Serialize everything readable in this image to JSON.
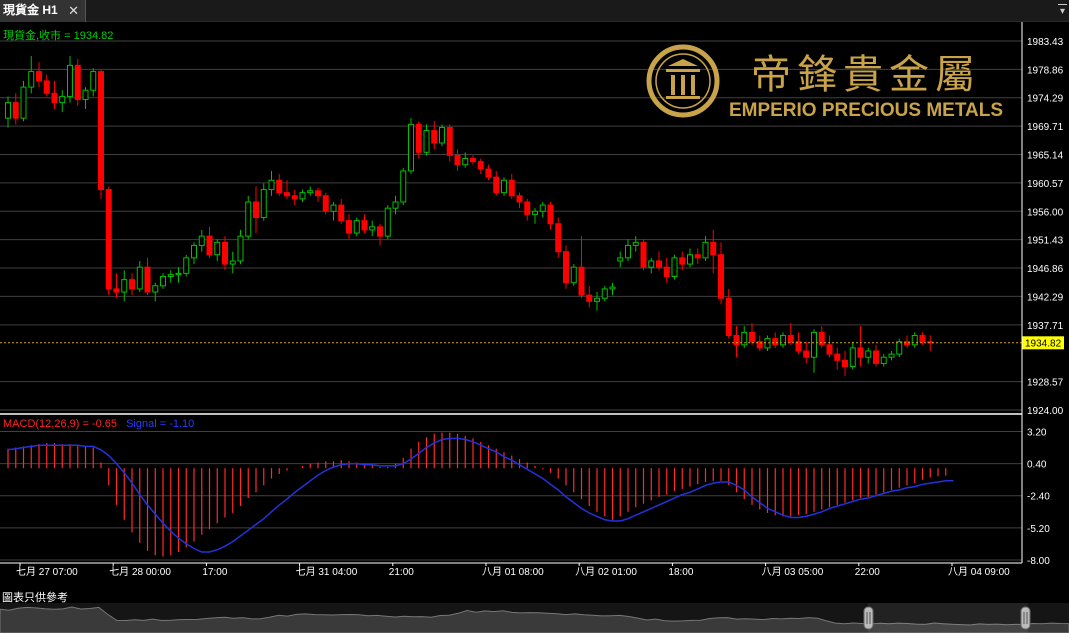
{
  "window": {
    "tab_title": "現貨金 H1",
    "tab_close": "✕",
    "menu_arrow": "▾"
  },
  "colors": {
    "bull": "#00c000",
    "bear": "#ff0000",
    "grid": "#404040",
    "axis_text": "#ffffff",
    "price_tag_bg": "#ffff00",
    "macd_label": "#ff2222",
    "signal_label": "#2233ff",
    "histogram": "#ff2a2a",
    "signal_line": "#2233dd",
    "logo_gold": "#c9a34a"
  },
  "main_panel": {
    "series_label": "現貨金,收市 = 1934.82",
    "current_price": 1934.82,
    "current_price_label": "1934.82",
    "price_ticks": [
      "1983.43",
      "1978.86",
      "1974.29",
      "1969.71",
      "1965.14",
      "1960.57",
      "1956.00",
      "1951.43",
      "1946.86",
      "1942.29",
      "1937.71",
      "1928.57",
      "1924.00"
    ]
  },
  "logo": {
    "chinese": "帝鋒貴金屬",
    "english": "EMPERIO PRECIOUS METALS",
    "icon": "emperio-seal-icon"
  },
  "macd_panel": {
    "label_macd": "MACD(12,26,9) = -0.65",
    "label_signal": "Signal = -1.10",
    "ticks": [
      "3.20",
      "0.40",
      "-2.40",
      "-5.20",
      "-8.00"
    ]
  },
  "time_axis": {
    "labels": [
      "七月 27 07:00",
      "七月 28 00:00",
      "17:00",
      "七月 31 04:00",
      "21:00",
      "八月 01 08:00",
      "八月 02 01:00",
      "18:00",
      "八月 03 05:00",
      "22:00",
      "八月 04 09:00"
    ]
  },
  "footer": {
    "disclaimer": "圖表只供參考"
  },
  "chart_data": {
    "type": "candlestick",
    "symbol": "現貨金",
    "timeframe": "H1",
    "close": 1934.82,
    "y_range": [
      1924.0,
      1986.0
    ],
    "x_labels": [
      "七月 27 07:00",
      "七月 28 00:00",
      "17:00",
      "七月 31 04:00",
      "21:00",
      "八月 01 08:00",
      "八月 02 01:00",
      "18:00",
      "八月 03 05:00",
      "22:00",
      "八月 04 09:00"
    ],
    "candles": [
      {
        "o": 1971.0,
        "h": 1974.5,
        "l": 1969.5,
        "c": 1973.5
      },
      {
        "o": 1973.5,
        "h": 1975.0,
        "l": 1970.0,
        "c": 1971.0
      },
      {
        "o": 1971.0,
        "h": 1977.0,
        "l": 1970.5,
        "c": 1976.0
      },
      {
        "o": 1976.0,
        "h": 1981.0,
        "l": 1975.0,
        "c": 1978.5
      },
      {
        "o": 1978.5,
        "h": 1980.0,
        "l": 1976.0,
        "c": 1977.0
      },
      {
        "o": 1977.0,
        "h": 1978.0,
        "l": 1974.5,
        "c": 1975.0
      },
      {
        "o": 1975.0,
        "h": 1977.0,
        "l": 1972.5,
        "c": 1973.5
      },
      {
        "o": 1973.5,
        "h": 1975.5,
        "l": 1972.0,
        "c": 1974.5
      },
      {
        "o": 1974.5,
        "h": 1981.0,
        "l": 1973.5,
        "c": 1979.5
      },
      {
        "o": 1979.5,
        "h": 1980.5,
        "l": 1973.0,
        "c": 1974.0
      },
      {
        "o": 1974.0,
        "h": 1976.0,
        "l": 1972.5,
        "c": 1975.5
      },
      {
        "o": 1975.5,
        "h": 1979.0,
        "l": 1974.5,
        "c": 1978.5
      },
      {
        "o": 1978.5,
        "h": 1978.8,
        "l": 1958.0,
        "c": 1959.5
      },
      {
        "o": 1959.5,
        "h": 1960.0,
        "l": 1942.5,
        "c": 1943.5
      },
      {
        "o": 1943.5,
        "h": 1946.0,
        "l": 1942.0,
        "c": 1943.0
      },
      {
        "o": 1943.0,
        "h": 1946.5,
        "l": 1941.5,
        "c": 1945.0
      },
      {
        "o": 1945.0,
        "h": 1946.0,
        "l": 1942.5,
        "c": 1943.5
      },
      {
        "o": 1943.5,
        "h": 1948.0,
        "l": 1943.0,
        "c": 1947.0
      },
      {
        "o": 1947.0,
        "h": 1948.5,
        "l": 1942.5,
        "c": 1943.0
      },
      {
        "o": 1943.0,
        "h": 1944.5,
        "l": 1941.5,
        "c": 1944.0
      },
      {
        "o": 1944.0,
        "h": 1946.0,
        "l": 1943.5,
        "c": 1945.5
      },
      {
        "o": 1945.5,
        "h": 1946.5,
        "l": 1944.5,
        "c": 1945.8
      },
      {
        "o": 1945.8,
        "h": 1947.0,
        "l": 1944.5,
        "c": 1946.0
      },
      {
        "o": 1946.0,
        "h": 1949.0,
        "l": 1945.5,
        "c": 1948.5
      },
      {
        "o": 1948.5,
        "h": 1951.0,
        "l": 1947.5,
        "c": 1950.5
      },
      {
        "o": 1950.5,
        "h": 1953.0,
        "l": 1949.5,
        "c": 1952.0
      },
      {
        "o": 1952.0,
        "h": 1953.5,
        "l": 1948.5,
        "c": 1949.0
      },
      {
        "o": 1949.0,
        "h": 1951.5,
        "l": 1948.0,
        "c": 1951.0
      },
      {
        "o": 1951.0,
        "h": 1952.0,
        "l": 1946.5,
        "c": 1947.5
      },
      {
        "o": 1947.5,
        "h": 1949.5,
        "l": 1946.0,
        "c": 1948.0
      },
      {
        "o": 1948.0,
        "h": 1953.0,
        "l": 1947.5,
        "c": 1952.0
      },
      {
        "o": 1952.0,
        "h": 1958.5,
        "l": 1951.5,
        "c": 1957.5
      },
      {
        "o": 1957.5,
        "h": 1960.0,
        "l": 1952.5,
        "c": 1955.0
      },
      {
        "o": 1955.0,
        "h": 1960.5,
        "l": 1954.5,
        "c": 1959.5
      },
      {
        "o": 1959.5,
        "h": 1962.5,
        "l": 1958.5,
        "c": 1961.0
      },
      {
        "o": 1961.0,
        "h": 1962.0,
        "l": 1958.5,
        "c": 1959.0
      },
      {
        "o": 1959.0,
        "h": 1961.0,
        "l": 1958.0,
        "c": 1958.5
      },
      {
        "o": 1958.5,
        "h": 1959.5,
        "l": 1957.0,
        "c": 1958.0
      },
      {
        "o": 1958.0,
        "h": 1959.5,
        "l": 1957.5,
        "c": 1959.0
      },
      {
        "o": 1959.0,
        "h": 1960.0,
        "l": 1958.5,
        "c": 1959.3
      },
      {
        "o": 1959.3,
        "h": 1959.8,
        "l": 1957.5,
        "c": 1958.5
      },
      {
        "o": 1958.5,
        "h": 1959.0,
        "l": 1955.5,
        "c": 1956.0
      },
      {
        "o": 1956.0,
        "h": 1957.5,
        "l": 1954.5,
        "c": 1957.0
      },
      {
        "o": 1957.0,
        "h": 1958.0,
        "l": 1954.0,
        "c": 1954.5
      },
      {
        "o": 1954.5,
        "h": 1955.5,
        "l": 1951.5,
        "c": 1952.5
      },
      {
        "o": 1952.5,
        "h": 1955.0,
        "l": 1952.0,
        "c": 1954.5
      },
      {
        "o": 1954.5,
        "h": 1955.5,
        "l": 1952.5,
        "c": 1953.0
      },
      {
        "o": 1953.0,
        "h": 1954.5,
        "l": 1952.0,
        "c": 1953.5
      },
      {
        "o": 1953.5,
        "h": 1954.0,
        "l": 1950.5,
        "c": 1952.0
      },
      {
        "o": 1952.0,
        "h": 1957.0,
        "l": 1951.5,
        "c": 1956.5
      },
      {
        "o": 1956.5,
        "h": 1958.5,
        "l": 1955.5,
        "c": 1957.5
      },
      {
        "o": 1957.5,
        "h": 1963.0,
        "l": 1957.0,
        "c": 1962.5
      },
      {
        "o": 1962.5,
        "h": 1971.0,
        "l": 1962.0,
        "c": 1970.0
      },
      {
        "o": 1970.0,
        "h": 1970.5,
        "l": 1964.5,
        "c": 1965.5
      },
      {
        "o": 1965.5,
        "h": 1970.0,
        "l": 1965.0,
        "c": 1969.0
      },
      {
        "o": 1969.0,
        "h": 1970.5,
        "l": 1966.0,
        "c": 1967.0
      },
      {
        "o": 1967.0,
        "h": 1970.0,
        "l": 1966.5,
        "c": 1969.5
      },
      {
        "o": 1969.5,
        "h": 1970.0,
        "l": 1964.0,
        "c": 1965.0
      },
      {
        "o": 1965.0,
        "h": 1966.0,
        "l": 1962.5,
        "c": 1963.5
      },
      {
        "o": 1963.5,
        "h": 1965.5,
        "l": 1963.0,
        "c": 1964.5
      },
      {
        "o": 1964.5,
        "h": 1965.0,
        "l": 1963.5,
        "c": 1964.0
      },
      {
        "o": 1964.0,
        "h": 1964.5,
        "l": 1962.0,
        "c": 1962.8
      },
      {
        "o": 1962.8,
        "h": 1963.5,
        "l": 1961.0,
        "c": 1961.5
      },
      {
        "o": 1961.5,
        "h": 1962.5,
        "l": 1958.5,
        "c": 1959.0
      },
      {
        "o": 1959.0,
        "h": 1961.5,
        "l": 1958.5,
        "c": 1961.0
      },
      {
        "o": 1961.0,
        "h": 1962.0,
        "l": 1958.0,
        "c": 1958.5
      },
      {
        "o": 1958.5,
        "h": 1959.0,
        "l": 1956.5,
        "c": 1957.5
      },
      {
        "o": 1957.5,
        "h": 1958.0,
        "l": 1954.5,
        "c": 1955.5
      },
      {
        "o": 1955.5,
        "h": 1956.5,
        "l": 1954.0,
        "c": 1956.0
      },
      {
        "o": 1956.0,
        "h": 1957.5,
        "l": 1955.0,
        "c": 1957.0
      },
      {
        "o": 1957.0,
        "h": 1957.5,
        "l": 1953.0,
        "c": 1954.0
      },
      {
        "o": 1954.0,
        "h": 1955.0,
        "l": 1948.5,
        "c": 1949.5
      },
      {
        "o": 1949.5,
        "h": 1950.5,
        "l": 1943.5,
        "c": 1944.5
      },
      {
        "o": 1944.5,
        "h": 1947.5,
        "l": 1944.0,
        "c": 1947.0
      },
      {
        "o": 1947.0,
        "h": 1952.0,
        "l": 1942.0,
        "c": 1942.5
      },
      {
        "o": 1942.5,
        "h": 1944.0,
        "l": 1940.5,
        "c": 1941.5
      },
      {
        "o": 1941.5,
        "h": 1943.0,
        "l": 1940.0,
        "c": 1942.0
      },
      {
        "o": 1942.0,
        "h": 1944.0,
        "l": 1941.5,
        "c": 1943.5
      },
      {
        "o": 1943.5,
        "h": 1944.5,
        "l": 1942.5,
        "c": 1943.8
      },
      {
        "o": 1948.0,
        "h": 1949.5,
        "l": 1947.0,
        "c": 1948.5
      },
      {
        "o": 1948.5,
        "h": 1951.5,
        "l": 1948.0,
        "c": 1950.5
      },
      {
        "o": 1950.5,
        "h": 1952.0,
        "l": 1949.5,
        "c": 1951.0
      },
      {
        "o": 1951.0,
        "h": 1951.5,
        "l": 1946.5,
        "c": 1947.0
      },
      {
        "o": 1947.0,
        "h": 1948.5,
        "l": 1946.0,
        "c": 1948.0
      },
      {
        "o": 1948.0,
        "h": 1949.5,
        "l": 1946.5,
        "c": 1947.0
      },
      {
        "o": 1947.0,
        "h": 1948.5,
        "l": 1944.5,
        "c": 1945.5
      },
      {
        "o": 1945.5,
        "h": 1949.0,
        "l": 1945.0,
        "c": 1948.5
      },
      {
        "o": 1948.5,
        "h": 1949.5,
        "l": 1946.5,
        "c": 1947.5
      },
      {
        "o": 1947.5,
        "h": 1950.0,
        "l": 1947.0,
        "c": 1949.0
      },
      {
        "o": 1949.0,
        "h": 1950.0,
        "l": 1947.5,
        "c": 1948.5
      },
      {
        "o": 1948.5,
        "h": 1952.0,
        "l": 1948.0,
        "c": 1951.0
      },
      {
        "o": 1951.0,
        "h": 1953.0,
        "l": 1946.0,
        "c": 1949.0
      },
      {
        "o": 1949.0,
        "h": 1951.0,
        "l": 1941.0,
        "c": 1942.0
      },
      {
        "o": 1942.0,
        "h": 1943.5,
        "l": 1935.5,
        "c": 1936.0
      },
      {
        "o": 1936.0,
        "h": 1937.5,
        "l": 1932.5,
        "c": 1934.5
      },
      {
        "o": 1934.5,
        "h": 1937.5,
        "l": 1934.0,
        "c": 1936.5
      },
      {
        "o": 1936.5,
        "h": 1938.0,
        "l": 1934.5,
        "c": 1935.0
      },
      {
        "o": 1935.0,
        "h": 1936.0,
        "l": 1933.5,
        "c": 1934.0
      },
      {
        "o": 1934.0,
        "h": 1936.0,
        "l": 1933.5,
        "c": 1935.5
      },
      {
        "o": 1935.5,
        "h": 1936.5,
        "l": 1934.0,
        "c": 1934.5
      },
      {
        "o": 1934.5,
        "h": 1936.5,
        "l": 1934.0,
        "c": 1936.0
      },
      {
        "o": 1936.0,
        "h": 1938.0,
        "l": 1934.5,
        "c": 1935.0
      },
      {
        "o": 1935.0,
        "h": 1936.5,
        "l": 1933.0,
        "c": 1933.5
      },
      {
        "o": 1933.5,
        "h": 1935.0,
        "l": 1931.5,
        "c": 1932.5
      },
      {
        "o": 1932.5,
        "h": 1937.0,
        "l": 1930.0,
        "c": 1936.5
      },
      {
        "o": 1936.5,
        "h": 1937.5,
        "l": 1934.0,
        "c": 1934.5
      },
      {
        "o": 1934.5,
        "h": 1936.0,
        "l": 1932.5,
        "c": 1933.0
      },
      {
        "o": 1933.0,
        "h": 1934.0,
        "l": 1930.5,
        "c": 1932.0
      },
      {
        "o": 1932.0,
        "h": 1933.5,
        "l": 1929.5,
        "c": 1931.0
      },
      {
        "o": 1931.0,
        "h": 1935.0,
        "l": 1930.5,
        "c": 1934.0
      },
      {
        "o": 1934.0,
        "h": 1937.5,
        "l": 1931.0,
        "c": 1932.5
      },
      {
        "o": 1932.5,
        "h": 1934.0,
        "l": 1931.5,
        "c": 1933.5
      },
      {
        "o": 1933.5,
        "h": 1934.5,
        "l": 1931.0,
        "c": 1931.5
      },
      {
        "o": 1931.5,
        "h": 1933.0,
        "l": 1931.0,
        "c": 1932.5
      },
      {
        "o": 1932.5,
        "h": 1933.5,
        "l": 1932.0,
        "c": 1933.0
      },
      {
        "o": 1933.0,
        "h": 1935.5,
        "l": 1932.5,
        "c": 1935.0
      },
      {
        "o": 1935.0,
        "h": 1936.0,
        "l": 1934.0,
        "c": 1934.5
      },
      {
        "o": 1934.5,
        "h": 1936.5,
        "l": 1934.0,
        "c": 1936.0
      },
      {
        "o": 1936.0,
        "h": 1936.5,
        "l": 1934.5,
        "c": 1935.0
      },
      {
        "o": 1935.0,
        "h": 1936.0,
        "l": 1933.5,
        "c": 1934.8
      }
    ],
    "macd": {
      "label": "MACD(12,26,9)",
      "value": -0.65,
      "signal_value": -1.1,
      "y_range": [
        -8.0,
        4.2
      ],
      "histogram": [
        1.7,
        1.8,
        1.9,
        2.0,
        2.1,
        2.2,
        2.2,
        2.1,
        2.1,
        2.0,
        1.9,
        1.8,
        0.5,
        -1.5,
        -3.2,
        -4.5,
        -5.6,
        -6.5,
        -7.2,
        -7.6,
        -7.7,
        -7.6,
        -7.3,
        -6.9,
        -6.4,
        -5.8,
        -5.3,
        -4.8,
        -4.3,
        -3.9,
        -3.3,
        -2.6,
        -2.1,
        -1.5,
        -0.9,
        -0.5,
        -0.2,
        0.0,
        0.2,
        0.4,
        0.5,
        0.6,
        0.6,
        0.7,
        0.6,
        0.5,
        0.4,
        0.3,
        0.1,
        0.1,
        0.4,
        0.9,
        1.7,
        2.3,
        2.7,
        3.0,
        3.1,
        3.1,
        3.0,
        2.8,
        2.6,
        2.3,
        2.0,
        1.7,
        1.4,
        1.1,
        0.8,
        0.5,
        0.2,
        -0.1,
        -0.4,
        -0.9,
        -1.5,
        -2.1,
        -2.7,
        -3.3,
        -3.8,
        -4.2,
        -4.5,
        -4.2,
        -3.8,
        -3.4,
        -3.1,
        -2.8,
        -2.5,
        -2.3,
        -2.0,
        -1.8,
        -1.6,
        -1.4,
        -1.2,
        -1.1,
        -1.1,
        -1.5,
        -2.1,
        -2.7,
        -3.2,
        -3.6,
        -3.9,
        -4.1,
        -4.2,
        -4.2,
        -4.1,
        -4.0,
        -3.8,
        -3.6,
        -3.4,
        -3.2,
        -3.0,
        -2.8,
        -2.6,
        -2.5,
        -2.3,
        -2.1,
        -1.9,
        -1.7,
        -1.5,
        -1.3,
        -1.0,
        -0.8,
        -0.7,
        -0.65
      ],
      "signal": [
        1.6,
        1.7,
        1.8,
        1.9,
        2.0,
        2.0,
        2.0,
        2.0,
        2.0,
        2.0,
        1.9,
        1.9,
        1.6,
        1.1,
        0.4,
        -0.4,
        -1.3,
        -2.3,
        -3.2,
        -4.0,
        -4.8,
        -5.5,
        -6.1,
        -6.6,
        -7.0,
        -7.3,
        -7.3,
        -7.1,
        -6.8,
        -6.4,
        -5.9,
        -5.4,
        -4.9,
        -4.4,
        -3.8,
        -3.2,
        -2.7,
        -2.1,
        -1.6,
        -1.1,
        -0.6,
        -0.2,
        0.1,
        0.3,
        0.4,
        0.4,
        0.3,
        0.3,
        0.2,
        0.2,
        0.2,
        0.4,
        0.8,
        1.3,
        1.8,
        2.2,
        2.5,
        2.6,
        2.6,
        2.5,
        2.3,
        2.0,
        1.7,
        1.4,
        1.0,
        0.7,
        0.3,
        -0.1,
        -0.5,
        -0.9,
        -1.4,
        -1.9,
        -2.5,
        -3.0,
        -3.5,
        -3.9,
        -4.2,
        -4.5,
        -4.6,
        -4.6,
        -4.4,
        -4.1,
        -3.8,
        -3.5,
        -3.2,
        -2.9,
        -2.6,
        -2.3,
        -2.1,
        -1.8,
        -1.5,
        -1.3,
        -1.2,
        -1.2,
        -1.5,
        -1.9,
        -2.5,
        -3.0,
        -3.5,
        -3.8,
        -4.1,
        -4.3,
        -4.3,
        -4.2,
        -4.0,
        -3.8,
        -3.5,
        -3.3,
        -3.1,
        -2.9,
        -2.7,
        -2.6,
        -2.4,
        -2.2,
        -2.0,
        -1.9,
        -1.7,
        -1.6,
        -1.4,
        -1.3,
        -1.2,
        -1.1,
        -1.1
      ]
    }
  }
}
